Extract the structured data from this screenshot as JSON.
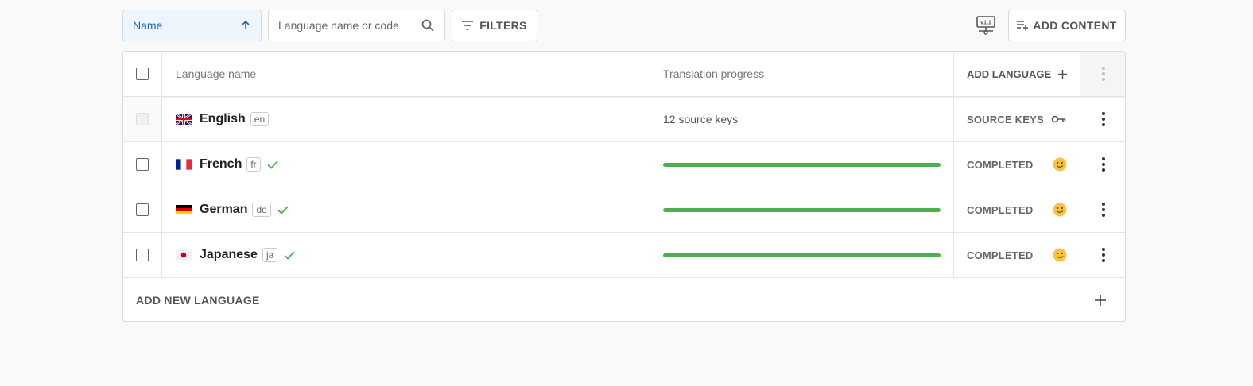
{
  "toolbar": {
    "sort_label": "Name",
    "search_placeholder": "Language name or code",
    "filters_label": "FILTERS",
    "version_icon": "version-icon",
    "add_content_label": "ADD CONTENT"
  },
  "table": {
    "headers": {
      "name": "Language name",
      "progress": "Translation progress",
      "add_language": "ADD LANGUAGE"
    },
    "rows": [
      {
        "name": "English",
        "code": "en",
        "flag": "gb",
        "progress_text": "12 source keys",
        "status": "SOURCE KEYS",
        "status_icon": "key-icon"
      },
      {
        "name": "French",
        "code": "fr",
        "flag": "fr",
        "progress": 1.0,
        "status": "COMPLETED",
        "status_icon": "smiley-icon"
      },
      {
        "name": "German",
        "code": "de",
        "flag": "de",
        "progress": 1.0,
        "status": "COMPLETED",
        "status_icon": "smiley-icon"
      },
      {
        "name": "Japanese",
        "code": "ja",
        "flag": "jp",
        "progress": 1.0,
        "status": "COMPLETED",
        "status_icon": "smiley-icon"
      }
    ],
    "footer_label": "ADD NEW LANGUAGE"
  },
  "colors": {
    "accent": "#1565c0",
    "progress": "#4caf50",
    "check": "#4caf50"
  }
}
